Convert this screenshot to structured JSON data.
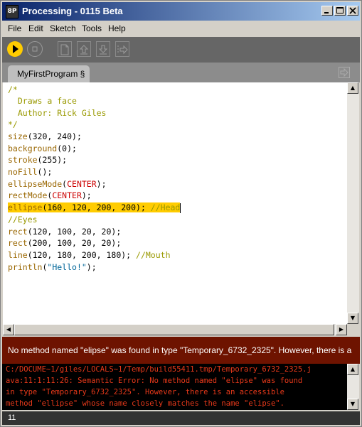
{
  "window": {
    "title": "Processing - 0115 Beta",
    "icon_text": "8P"
  },
  "menu": [
    "File",
    "Edit",
    "Sketch",
    "Tools",
    "Help"
  ],
  "toolbar": [
    "run-button",
    "stop-button",
    "new-button",
    "open-button",
    "save-button",
    "export-button"
  ],
  "tab": {
    "label": "MyFirstProgram §"
  },
  "code": [
    [
      [
        "k-comment",
        "/*"
      ]
    ],
    [
      [
        "k-comment",
        "  Draws a face"
      ]
    ],
    [
      [
        "k-comment",
        "  Author: Rick Giles"
      ]
    ],
    [
      [
        "k-comment",
        "*/"
      ]
    ],
    [
      [
        "k-fn",
        "size"
      ],
      [
        "k-plain",
        "(320, 240);"
      ]
    ],
    [
      [
        "k-fn",
        "background"
      ],
      [
        "k-plain",
        "(0);"
      ]
    ],
    [
      [
        "k-fn",
        "stroke"
      ],
      [
        "k-plain",
        "(255);"
      ]
    ],
    [
      [
        "k-fn",
        "noFill"
      ],
      [
        "k-plain",
        "();"
      ]
    ],
    [
      [
        "k-fn",
        "ellipseMode"
      ],
      [
        "k-plain",
        "("
      ],
      [
        "k-const",
        "CENTER"
      ],
      [
        "k-plain",
        ");"
      ]
    ],
    [
      [
        "k-fn",
        "rectMode"
      ],
      [
        "k-plain",
        "("
      ],
      [
        "k-const",
        "CENTER"
      ],
      [
        "k-plain",
        ");"
      ]
    ],
    [
      [
        "k-fn",
        "ellipse"
      ],
      [
        "k-plain",
        "(160, 120, 200, 200); "
      ],
      [
        "k-comment",
        "//Head"
      ]
    ],
    [
      [
        "k-comment",
        "//Eyes"
      ]
    ],
    [
      [
        "k-fn",
        "rect"
      ],
      [
        "k-plain",
        "(120, 100, 20, 20);"
      ]
    ],
    [
      [
        "k-fn",
        "rect"
      ],
      [
        "k-plain",
        "(200, 100, 20, 20);"
      ]
    ],
    [
      [
        "k-fn",
        "line"
      ],
      [
        "k-plain",
        "(120, 180, 200, 180); "
      ],
      [
        "k-comment",
        "//Mouth"
      ]
    ],
    [
      [
        "k-fn",
        "println"
      ],
      [
        "k-plain",
        "("
      ],
      [
        "k-str",
        "\"Hello!\""
      ],
      [
        "k-plain",
        ");"
      ]
    ]
  ],
  "status": {
    "message": "No method named \"elipse\" was found in type \"Temporary_6732_2325\". However, there is a"
  },
  "console": [
    "C:/DOCUME~1/giles/LOCALS~1/Temp/build55411.tmp/Temporary_6732_2325.j",
    "ava:11:1:11:26: Semantic Error: No method named \"elipse\" was found",
    "in type \"Temporary_6732_2325\". However, there is an accessible",
    "method \"ellipse\" whose name closely matches the name \"elipse\"."
  ],
  "line_indicator": "11",
  "colors": {
    "toolbar_bg": "#666666",
    "run_button": "#ffcc00",
    "status_bg": "#6e1300",
    "console_text": "#e8391a",
    "highlight": "#ffcc00"
  }
}
